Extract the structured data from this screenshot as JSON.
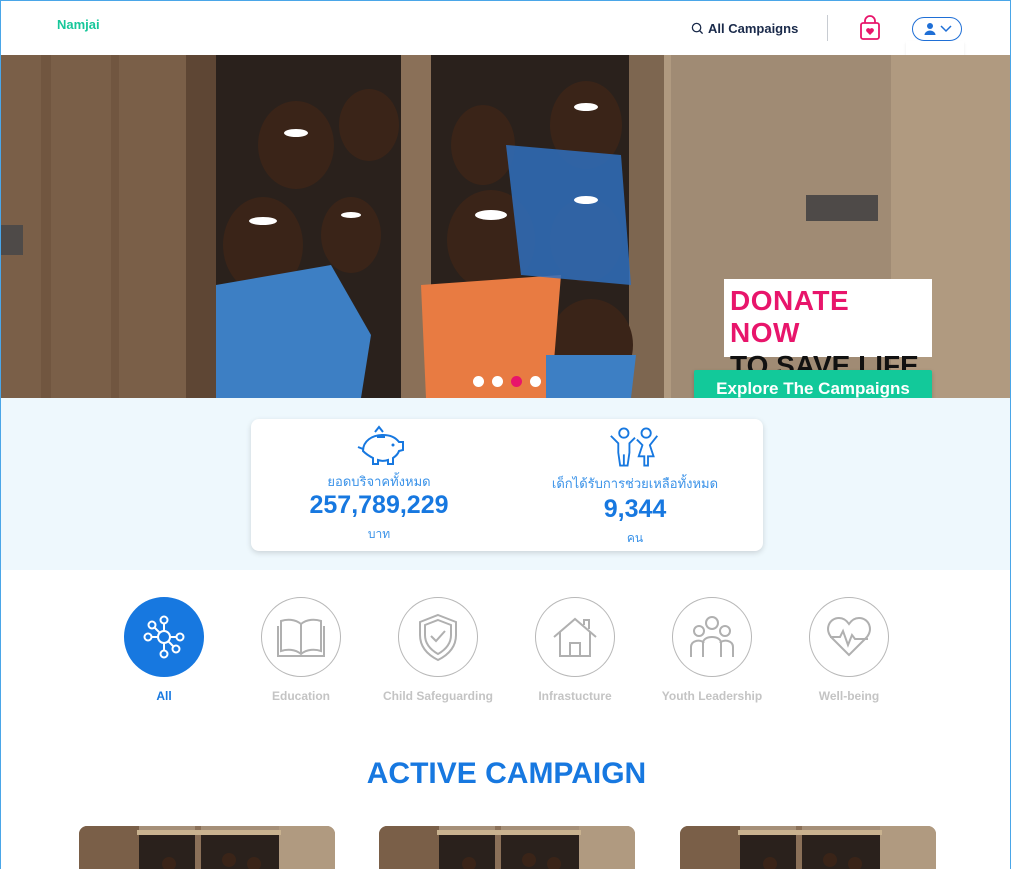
{
  "header": {
    "logo": "Namjai",
    "search_label": "All Campaigns"
  },
  "hero": {
    "title_line1": "DONATE NOW",
    "title_line2": "TO SAVE LIFE",
    "cta_label": "Explore The Campaigns",
    "slides_total": 4,
    "active_slide": 3
  },
  "stats": {
    "donations": {
      "label": "ยอดบริจาคทั้งหมด",
      "value": "257,789,229",
      "unit": "บาท",
      "icon": "piggy-bank-icon"
    },
    "children": {
      "label": "เด็กได้รับการช่วยเหลือทั้งหมด",
      "value": "9,344",
      "unit": "คน",
      "icon": "children-icon"
    }
  },
  "categories": [
    {
      "name": "All",
      "icon": "network-icon",
      "active": true
    },
    {
      "name": "Education",
      "icon": "book-icon",
      "active": false
    },
    {
      "name": "Child Safeguarding",
      "icon": "shield-icon",
      "active": false
    },
    {
      "name": "Infrastucture",
      "icon": "house-icon",
      "active": false
    },
    {
      "name": "Youth Leadership",
      "icon": "people-icon",
      "active": false
    },
    {
      "name": "Well-being",
      "icon": "heart-pulse-icon",
      "active": false
    }
  ],
  "section": {
    "title": "ACTIVE CAMPAIGN"
  },
  "colors": {
    "brand": "#16c79a",
    "primary": "#1778e0",
    "accent": "#e8156b"
  }
}
